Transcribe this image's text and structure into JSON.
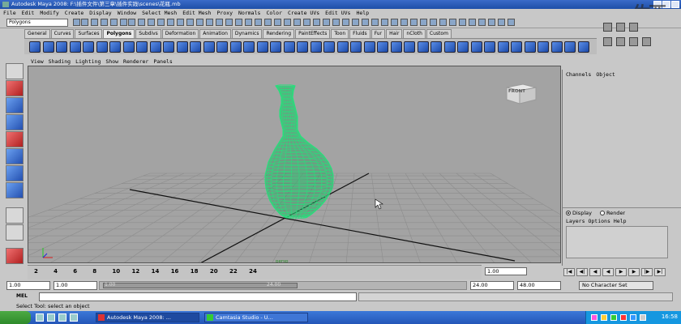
{
  "window": {
    "title": "Autodesk Maya 2008: F:\\插件文件\\第三章\\插件实践\\scenes\\花瓶.mb"
  },
  "menubar": [
    "File",
    "Edit",
    "Modify",
    "Create",
    "Display",
    "Window",
    "Select Mesh",
    "Edit Mesh",
    "Proxy",
    "Normals",
    "Color",
    "Create UVs",
    "Edit UVs",
    "Help"
  ],
  "status_line": {
    "menu_set": "Polygons"
  },
  "shelf": {
    "tabs": [
      "General",
      "Curves",
      "Surfaces",
      "Polygons",
      "Subdivs",
      "Deformation",
      "Animation",
      "Dynamics",
      "Rendering",
      "PaintEffects",
      "Toon",
      "Fluids",
      "Fur",
      "Hair",
      "nCloth",
      "Custom"
    ],
    "active_tab": "Polygons"
  },
  "panel_menu": [
    "View",
    "Shading",
    "Lighting",
    "Show",
    "Renderer",
    "Panels"
  ],
  "viewport": {
    "camera_label": "persp",
    "viewcube_label": "FRONT"
  },
  "channel_box": {
    "menu": [
      "Channels",
      "Object"
    ]
  },
  "layer_editor": {
    "modes": [
      {
        "label": "Display",
        "selected": true
      },
      {
        "label": "Render",
        "selected": false
      }
    ],
    "menu": [
      "Layers",
      "Options",
      "Help"
    ]
  },
  "time_slider": {
    "ticks": [
      "2",
      "4",
      "6",
      "8",
      "10",
      "12",
      "14",
      "16",
      "18",
      "20",
      "22",
      "24"
    ],
    "current_frame": "1.00"
  },
  "range_slider": {
    "start_time": "1.00",
    "playback_start": "1.00",
    "slider_start": "1.00",
    "slider_end": "24.00",
    "playback_end": "24.00",
    "end_time": "48.00",
    "character_set": "No Character Set"
  },
  "command_line": {
    "label": "MEL"
  },
  "help_line": "Select Tool: select an object",
  "taskbar": {
    "buttons": [
      {
        "label": "Autodesk Maya 2008: ...",
        "active": true
      },
      {
        "label": "Camtasia Studio - U...",
        "active": false
      }
    ],
    "clock": "16:58"
  },
  "colors": {
    "wireframe": "#27e07c",
    "viewport_bg": "#a3a3a3",
    "grid": "#8c8c8c",
    "titlebar": "#1e4fa8"
  },
  "watermark": "佐西"
}
